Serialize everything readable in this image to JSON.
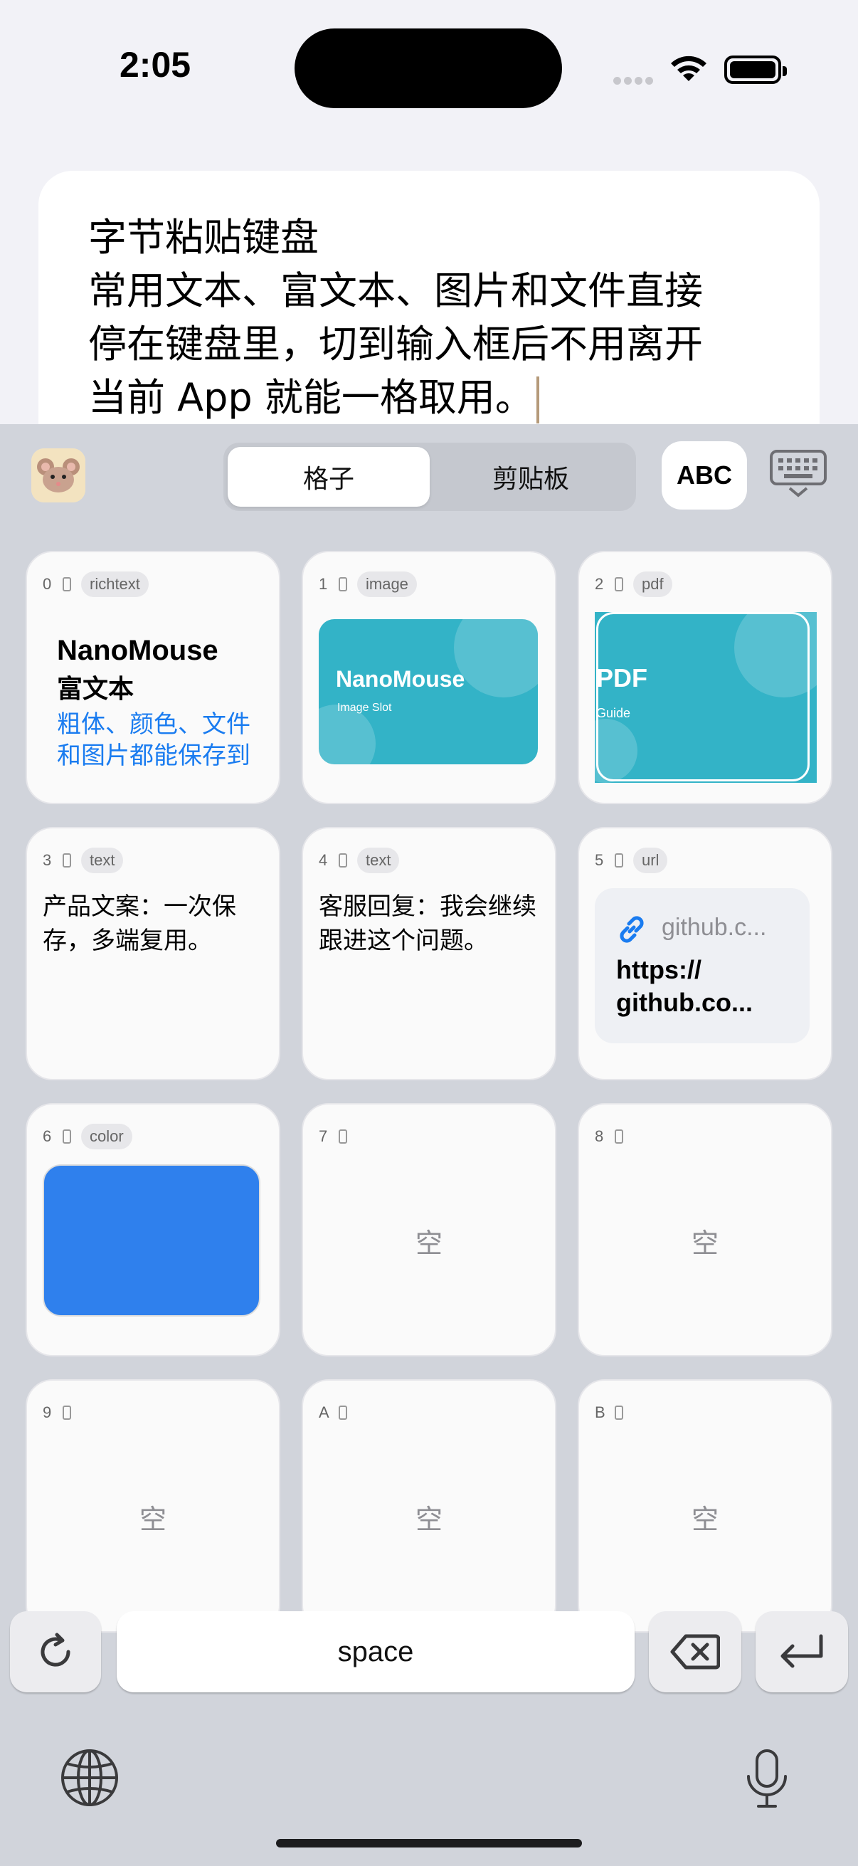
{
  "status_bar": {
    "time": "2:05"
  },
  "note": {
    "lines": [
      "字节粘贴键盘",
      "常用文本、富文本、图片和文件直接",
      "停在键盘里，切到输入框后不用离开",
      "当前 App 就能一格取用。"
    ]
  },
  "toolbar": {
    "segments": [
      "格子",
      "剪贴板"
    ],
    "selected_segment": "格子",
    "abc_label": "ABC"
  },
  "cells": [
    {
      "index": "0",
      "tag": "richtext",
      "title": "NanoMouse",
      "subtitle": "富文本",
      "body": "粗体、颜色、文件和图片都能保存到格子"
    },
    {
      "index": "1",
      "tag": "image",
      "title": "NanoMouse",
      "caption": "Image Slot"
    },
    {
      "index": "2",
      "tag": "pdf",
      "title": "PDF",
      "caption": "Guide"
    },
    {
      "index": "3",
      "tag": "text",
      "text": "产品文案：一次保存，多端复用。"
    },
    {
      "index": "4",
      "tag": "text",
      "text": "客服回复：我会继续跟进这个问题。"
    },
    {
      "index": "5",
      "tag": "url",
      "host": "github.c...",
      "url_line1": "https://",
      "url_line2": "github.co..."
    },
    {
      "index": "6",
      "tag": "color",
      "color": "#2f80ed"
    },
    {
      "index": "7",
      "empty": "空"
    },
    {
      "index": "8",
      "empty": "空"
    },
    {
      "index": "9",
      "empty": "空"
    },
    {
      "index": "A",
      "empty": "空"
    },
    {
      "index": "B",
      "empty": "空"
    }
  ],
  "bottom_row": {
    "space_label": "space"
  },
  "colors": {
    "accent_blue": "#1a7cf0",
    "thumb_teal": "#33b3c7",
    "keyboard_bg": "#d1d4db"
  },
  "icons": [
    "refresh-icon",
    "delete-backward-icon",
    "return-icon",
    "globe-icon",
    "microphone-icon",
    "keyboard-dismiss-icon",
    "link-icon",
    "wifi-icon",
    "battery-icon"
  ]
}
